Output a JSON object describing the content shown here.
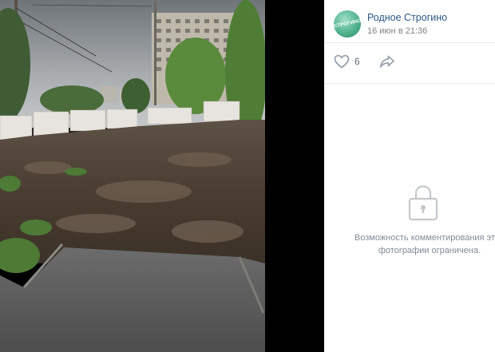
{
  "author": {
    "name": "Родное Строгино",
    "date": "16 июн в 21:36",
    "avatar_text": "СТРОГИНО"
  },
  "actions": {
    "like_count": "6",
    "like_icon": "heart-icon",
    "share_icon": "share-icon"
  },
  "comments": {
    "lock_icon": "lock-icon",
    "line1": "Возможность комментирования этой",
    "line2": "фотографии ограничена."
  },
  "colors": {
    "link": "#2a5885",
    "muted": "#828282",
    "icon": "#99a2ad",
    "viewer_bg": "#000000"
  }
}
